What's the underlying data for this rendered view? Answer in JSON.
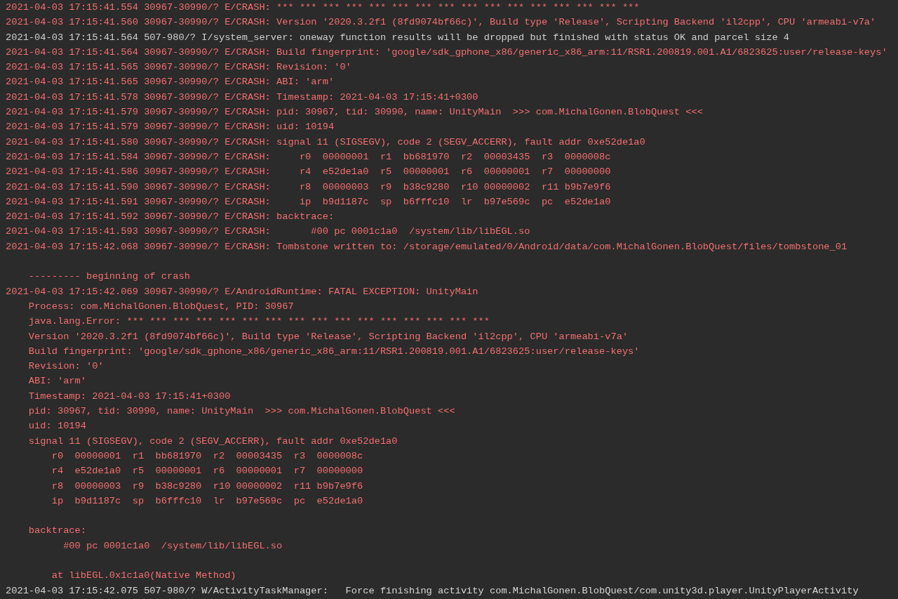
{
  "log_lines": [
    {
      "kind": "error",
      "text": "2021-04-03 17:15:41.554 30967-30990/? E/CRASH: *** *** *** *** *** *** *** *** *** *** *** *** *** *** *** ***"
    },
    {
      "kind": "error",
      "text": "2021-04-03 17:15:41.560 30967-30990/? E/CRASH: Version '2020.3.2f1 (8fd9074bf66c)', Build type 'Release', Scripting Backend 'il2cpp', CPU 'armeabi-v7a'"
    },
    {
      "kind": "info",
      "text": "2021-04-03 17:15:41.564 507-980/? I/system_server: oneway function results will be dropped but finished with status OK and parcel size 4"
    },
    {
      "kind": "error",
      "text": "2021-04-03 17:15:41.564 30967-30990/? E/CRASH: Build fingerprint: 'google/sdk_gphone_x86/generic_x86_arm:11/RSR1.200819.001.A1/6823625:user/release-keys'"
    },
    {
      "kind": "error",
      "text": "2021-04-03 17:15:41.565 30967-30990/? E/CRASH: Revision: '0'"
    },
    {
      "kind": "error",
      "text": "2021-04-03 17:15:41.565 30967-30990/? E/CRASH: ABI: 'arm'"
    },
    {
      "kind": "error",
      "text": "2021-04-03 17:15:41.578 30967-30990/? E/CRASH: Timestamp: 2021-04-03 17:15:41+0300"
    },
    {
      "kind": "error",
      "text": "2021-04-03 17:15:41.579 30967-30990/? E/CRASH: pid: 30967, tid: 30990, name: UnityMain  >>> com.MichalGonen.BlobQuest <<<"
    },
    {
      "kind": "error",
      "text": "2021-04-03 17:15:41.579 30967-30990/? E/CRASH: uid: 10194"
    },
    {
      "kind": "error",
      "text": "2021-04-03 17:15:41.580 30967-30990/? E/CRASH: signal 11 (SIGSEGV), code 2 (SEGV_ACCERR), fault addr 0xe52de1a0"
    },
    {
      "kind": "error",
      "text": "2021-04-03 17:15:41.584 30967-30990/? E/CRASH:     r0  00000001  r1  bb681970  r2  00003435  r3  0000008c"
    },
    {
      "kind": "error",
      "text": "2021-04-03 17:15:41.586 30967-30990/? E/CRASH:     r4  e52de1a0  r5  00000001  r6  00000001  r7  00000000"
    },
    {
      "kind": "error",
      "text": "2021-04-03 17:15:41.590 30967-30990/? E/CRASH:     r8  00000003  r9  b38c9280  r10 00000002  r11 b9b7e9f6"
    },
    {
      "kind": "error",
      "text": "2021-04-03 17:15:41.591 30967-30990/? E/CRASH:     ip  b9d1187c  sp  b6fffc10  lr  b97e569c  pc  e52de1a0"
    },
    {
      "kind": "error",
      "text": "2021-04-03 17:15:41.592 30967-30990/? E/CRASH: backtrace:"
    },
    {
      "kind": "error",
      "text": "2021-04-03 17:15:41.593 30967-30990/? E/CRASH:       #00 pc 0001c1a0  /system/lib/libEGL.so"
    },
    {
      "kind": "error",
      "text": "2021-04-03 17:15:42.068 30967-30990/? E/CRASH: Tombstone written to: /storage/emulated/0/Android/data/com.MichalGonen.BlobQuest/files/tombstone_01"
    },
    {
      "kind": "blank"
    },
    {
      "kind": "error",
      "text": "    --------- beginning of crash"
    },
    {
      "kind": "error",
      "text": "2021-04-03 17:15:42.069 30967-30990/? E/AndroidRuntime: FATAL EXCEPTION: UnityMain"
    },
    {
      "kind": "error",
      "text": "    Process: com.MichalGonen.BlobQuest, PID: 30967"
    },
    {
      "kind": "error",
      "text": "    java.lang.Error: *** *** *** *** *** *** *** *** *** *** *** *** *** *** *** ***"
    },
    {
      "kind": "error",
      "text": "    Version '2020.3.2f1 (8fd9074bf66c)', Build type 'Release', Scripting Backend 'il2cpp', CPU 'armeabi-v7a'"
    },
    {
      "kind": "error",
      "text": "    Build fingerprint: 'google/sdk_gphone_x86/generic_x86_arm:11/RSR1.200819.001.A1/6823625:user/release-keys'"
    },
    {
      "kind": "error",
      "text": "    Revision: '0'"
    },
    {
      "kind": "error",
      "text": "    ABI: 'arm'"
    },
    {
      "kind": "error",
      "text": "    Timestamp: 2021-04-03 17:15:41+0300"
    },
    {
      "kind": "error",
      "text": "    pid: 30967, tid: 30990, name: UnityMain  >>> com.MichalGonen.BlobQuest <<<"
    },
    {
      "kind": "error",
      "text": "    uid: 10194"
    },
    {
      "kind": "error",
      "text": "    signal 11 (SIGSEGV), code 2 (SEGV_ACCERR), fault addr 0xe52de1a0"
    },
    {
      "kind": "error",
      "text": "        r0  00000001  r1  bb681970  r2  00003435  r3  0000008c"
    },
    {
      "kind": "error",
      "text": "        r4  e52de1a0  r5  00000001  r6  00000001  r7  00000000"
    },
    {
      "kind": "error",
      "text": "        r8  00000003  r9  b38c9280  r10 00000002  r11 b9b7e9f6"
    },
    {
      "kind": "error",
      "text": "        ip  b9d1187c  sp  b6fffc10  lr  b97e569c  pc  e52de1a0"
    },
    {
      "kind": "blank"
    },
    {
      "kind": "error",
      "text": "    backtrace:"
    },
    {
      "kind": "error",
      "text": "          #00 pc 0001c1a0  /system/lib/libEGL.so"
    },
    {
      "kind": "blank"
    },
    {
      "kind": "error",
      "text": "        at libEGL.0x1c1a0(Native Method)"
    },
    {
      "kind": "warn",
      "text": "2021-04-03 17:15:42.075 507-980/? W/ActivityTaskManager:   Force finishing activity com.MichalGonen.BlobQuest/com.unity3d.player.UnityPlayerActivity"
    }
  ]
}
